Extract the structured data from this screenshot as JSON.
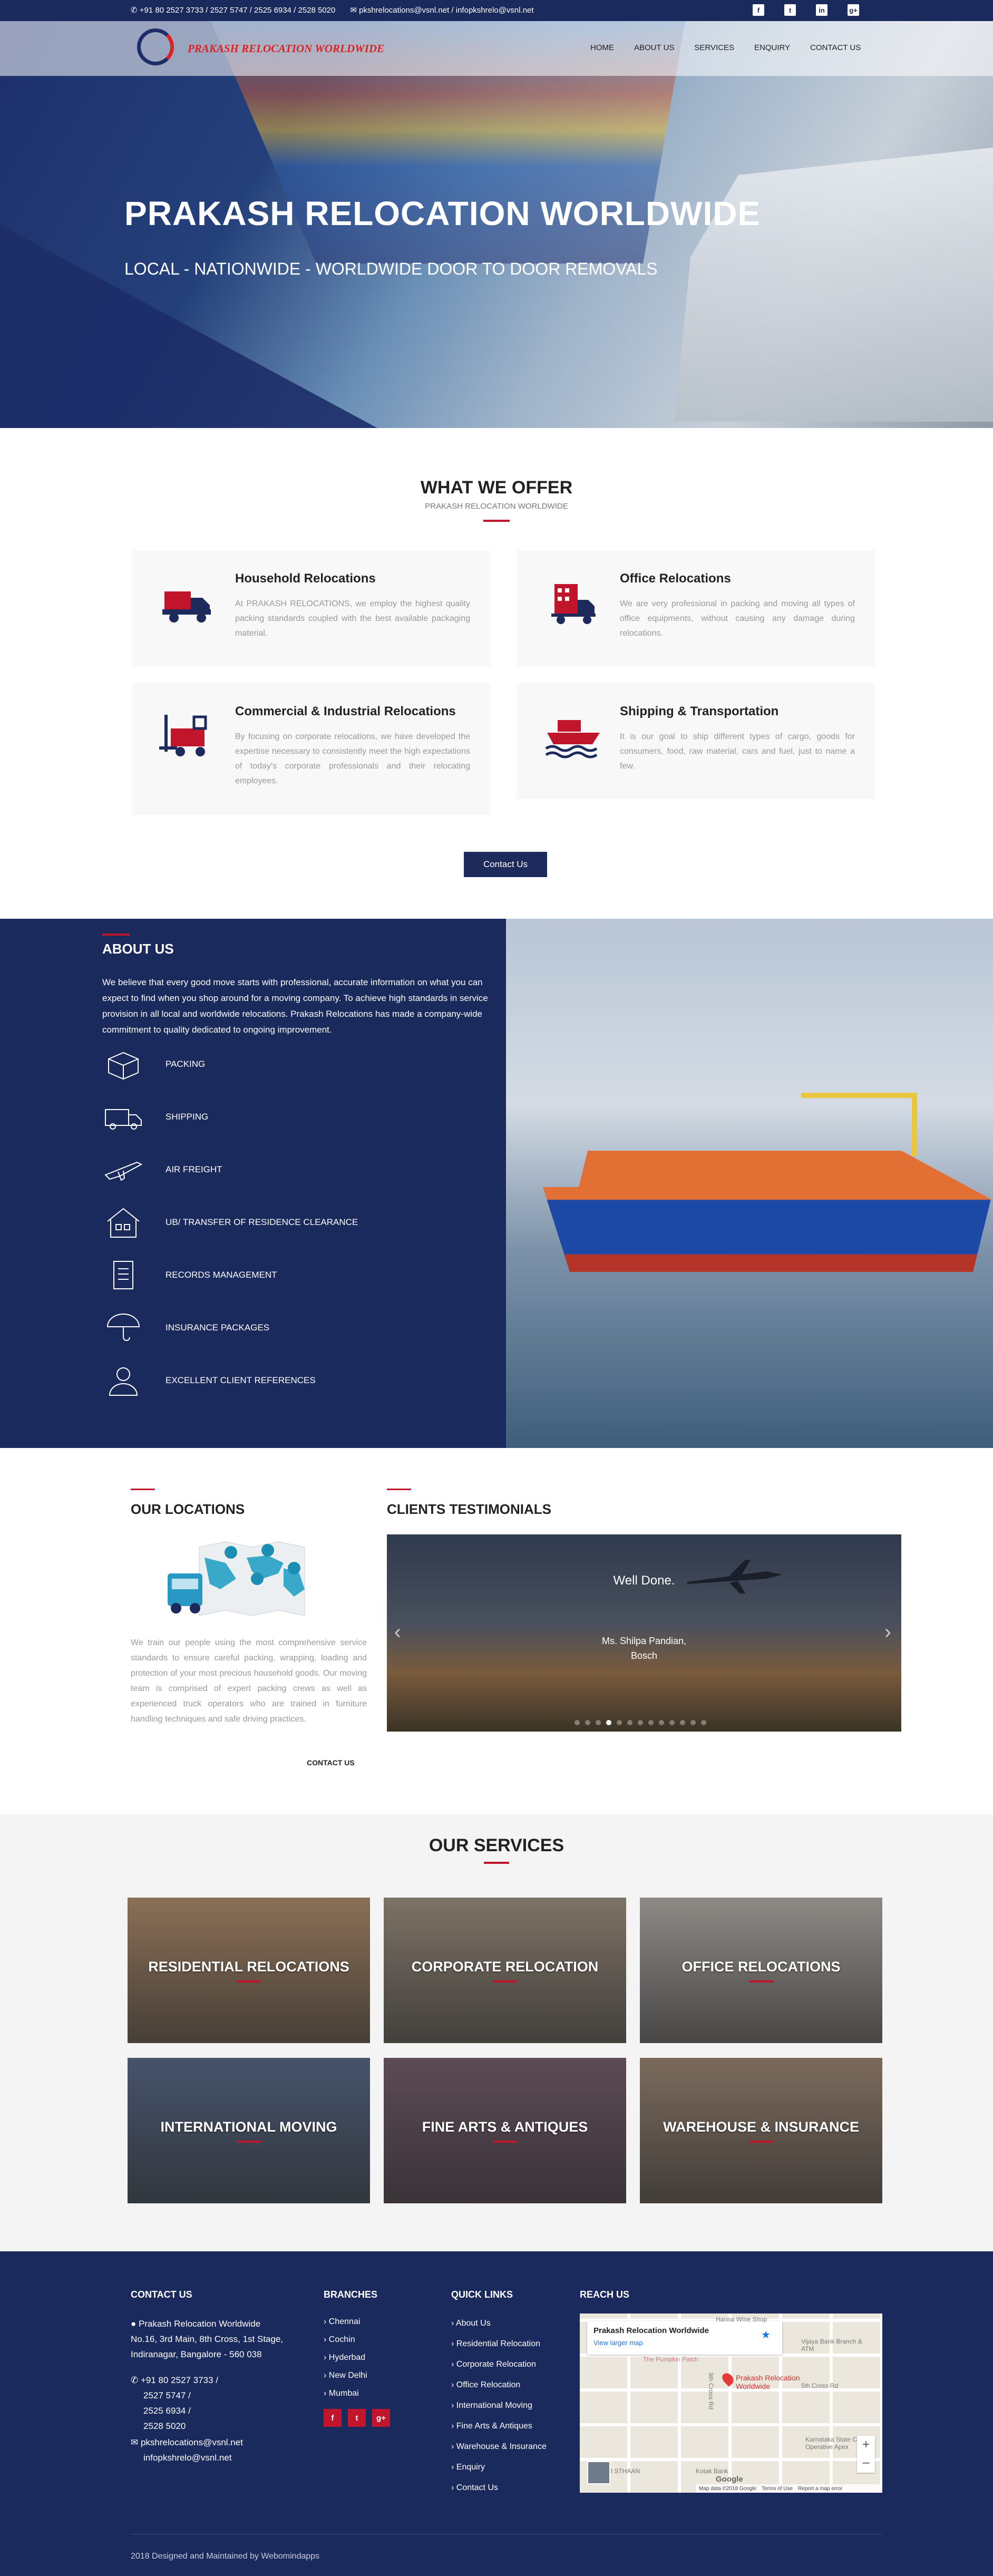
{
  "topbar": {
    "phone": "+91 80 2527 3733 / 2527 5747 / 2525 6934 / 2528 5020",
    "email": "pkshrelocations@vsnl.net / infopkshrelo@vsnl.net",
    "social": [
      "f",
      "t",
      "in",
      "g+"
    ]
  },
  "header": {
    "logo_text": "PRAKASH RELOCATION WORLDWIDE",
    "menu": [
      "HOME",
      "ABOUT US",
      "SERVICES",
      "ENQUIRY",
      "CONTACT US"
    ]
  },
  "hero": {
    "title": "PRAKASH RELOCATION WORLDWIDE",
    "subtitle": "LOCAL - NATIONWIDE - WORLDWIDE DOOR TO DOOR REMOVALS"
  },
  "offer": {
    "title": "WHAT WE OFFER",
    "subtitle": "PRAKASH RELOCATION WORLDWIDE",
    "cards": [
      {
        "title": "Household Relocations",
        "text": "At PRAKASH RELOCATIONS, we employ the highest quality packing standards coupled with the best available packaging material.",
        "icon": "truck-icon"
      },
      {
        "title": "Office Relocations",
        "text": "We are very professional in packing and moving all types of office equipments, without causing any damage during relocations.",
        "icon": "office-truck-icon"
      },
      {
        "title": "Commercial & Industrial Relocations",
        "text": "By focusing on corporate relocations, we have developed the expertise necessary to consistently meet the high expectations of today's corporate professionals and their relocating employees.",
        "icon": "forklift-icon"
      },
      {
        "title": "Shipping & Transportation",
        "text": "It is our goal to ship different types of cargo, goods for consumers, food, raw material, cars and fuel, just to name a few.",
        "icon": "ship-icon"
      }
    ],
    "button": "Contact Us"
  },
  "about": {
    "title": "ABOUT US",
    "text": "We believe that every good move starts with professional, accurate information on what you can expect to find when you shop around for a moving company. To achieve high standards in service provision in all local and worldwide relocations. Prakash Relocations has made a company-wide commitment to quality dedicated to ongoing improvement.",
    "items": [
      {
        "label": "PACKING",
        "icon": "box-icon"
      },
      {
        "label": "SHIPPING",
        "icon": "van-icon"
      },
      {
        "label": "AIR FREIGHT",
        "icon": "plane-icon"
      },
      {
        "label": "UB/ TRANSFER OF RESIDENCE CLEARANCE",
        "icon": "house-icon"
      },
      {
        "label": "RECORDS MANAGEMENT",
        "icon": "clipboard-icon"
      },
      {
        "label": "INSURANCE PACKAGES",
        "icon": "umbrella-icon"
      },
      {
        "label": "EXCELLENT CLIENT REFERENCES",
        "icon": "user-icon"
      }
    ]
  },
  "locations": {
    "title": "OUR LOCATIONS",
    "text": "We train our people using the most comprehensive service standards to ensure careful packing, wrapping, loading and protection of your most precious household goods. Our moving team is comprised of expert packing crews as well as experienced truck operators who are trained in furniture handling techniques and safe driving practices.",
    "link": "CONTACT US"
  },
  "testimonials": {
    "title": "CLIENTS TESTIMONIALS",
    "quote": "Well Done.",
    "author": "Ms. Shilpa Pandian,",
    "company": "Bosch",
    "dots": 13,
    "active_dot": 3
  },
  "services": {
    "title": "OUR SERVICES",
    "tiles": [
      {
        "label": "RESIDENTIAL RELOCATIONS",
        "color": "#8a6f55"
      },
      {
        "label": "CORPORATE RELOCATION",
        "color": "#7d7266"
      },
      {
        "label": "OFFICE RELOCATIONS",
        "color": "#8d8985"
      },
      {
        "label": "INTERNATIONAL MOVING",
        "color": "#46536b"
      },
      {
        "label": "FINE ARTS & ANTIQUES",
        "color": "#5c4a55"
      },
      {
        "label": "WAREHOUSE & INSURANCE",
        "color": "#7b6a5c"
      }
    ]
  },
  "footer": {
    "contact_title": "CONTACT US",
    "address": [
      "Prakash Relocation Worldwide",
      "No.16, 3rd Main, 8th Cross, 1st Stage,",
      "Indiranagar, Bangalore - 560 038"
    ],
    "phones": [
      "+91 80 2527 3733 /",
      "2527 5747 /",
      "2525 6934 /",
      "2528 5020"
    ],
    "emails": [
      "pkshrelocations@vsnl.net",
      "infopkshrelo@vsnl.net"
    ],
    "branches_title": "BRANCHES",
    "branches": [
      "Chennai",
      "Cochin",
      "Hyderbad",
      "New Delhi",
      "Mumbai"
    ],
    "social": [
      "f",
      "t",
      "g+"
    ],
    "links_title": "QUICK LINKS",
    "links": [
      "About Us",
      "Residential Relocation",
      "Corporate Relocation",
      "Office Relocation",
      "International Moving",
      "Fine Arts & Antiques",
      "Warehouse & Insurance",
      "Enquiry",
      "Contact Us"
    ],
    "reach_title": "REACH US",
    "map": {
      "place": "Prakash Relocation Worldwide",
      "larger": "View larger map",
      "pin_label_1": "Prakash Relocation",
      "pin_label_2": "Worldwide",
      "labels": [
        "Hanna Wine Shop",
        "Vijaya Bank Branch & ATM",
        "5th Cross Rd",
        "9th Cross Rd",
        "Karnataka State Co-Operative Apex",
        "OGI STHAAN",
        "The Pumpkin Patch",
        "Kotak Bank"
      ],
      "copyright": "Map data ©2018 Google",
      "terms": "Terms of Use",
      "report": "Report a map error"
    },
    "copyright": "2018 Designed and Maintained by Webomindapps"
  }
}
